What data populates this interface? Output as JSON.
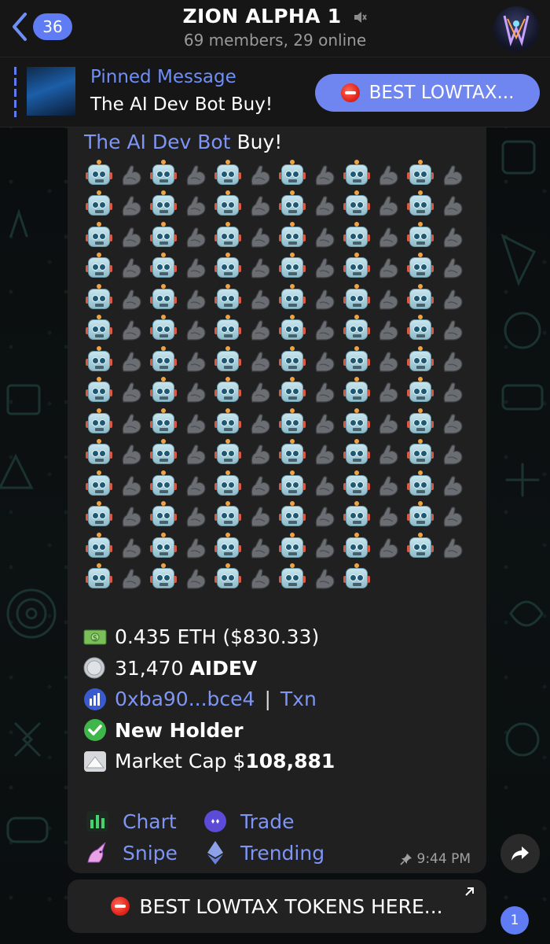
{
  "header": {
    "back_badge": "36",
    "title": "ZION ALPHA 1",
    "subtitle": "69 members, 29 online",
    "icons": [
      "back-chevron-icon",
      "muted-speaker-icon",
      "group-avatar"
    ]
  },
  "pinned": {
    "label": "Pinned Message",
    "text": "The AI Dev Bot Buy!",
    "button_label": "BEST LOWTAX..."
  },
  "message": {
    "sender_name": "The AI Dev Bot",
    "sender_suffix": " Buy!",
    "emoji_pattern": [
      "robot",
      "muscle"
    ],
    "emoji_rows": 14,
    "emoji_last_row_count": 9,
    "eth_amount": "0.435 ETH ($830.33)",
    "token_amount_value": "31,470",
    "token_symbol": "AIDEV",
    "address": "0xba90...bce4",
    "txn_label": "Txn",
    "holder_status": "New Holder",
    "market_cap_label": "Market Cap $",
    "market_cap_value": "108,881",
    "buttons": {
      "chart": "Chart",
      "trade": "Trade",
      "snipe": "Snipe",
      "trending": "Trending"
    },
    "time": "9:44 PM"
  },
  "cta_button": "BEST LOWTAX TOKENS HERE...",
  "unread_count": "1",
  "colors": {
    "accent": "#7e95f5",
    "badge": "#5f7cf4",
    "bubble": "#202020",
    "header": "#161616"
  }
}
